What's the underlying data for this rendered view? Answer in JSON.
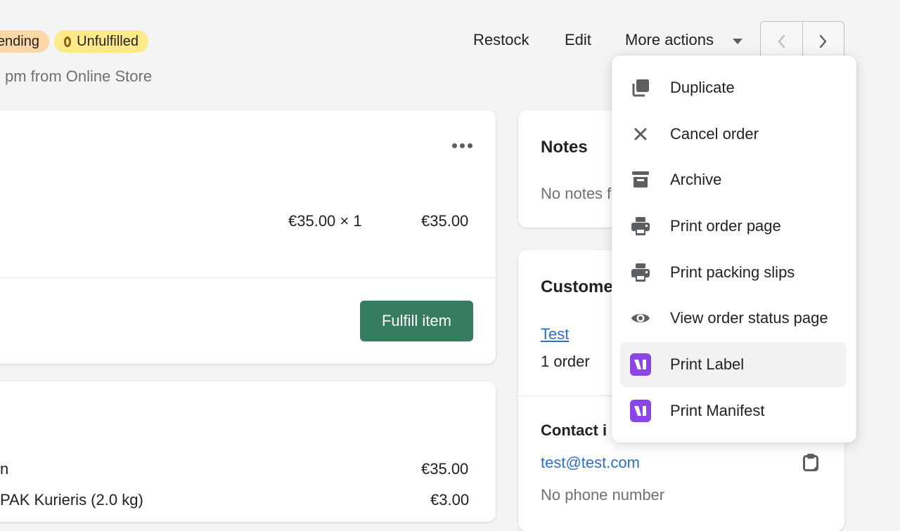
{
  "header": {
    "badges": [
      {
        "label": "Pending",
        "visible_text": "ending",
        "color": "#fcd8a8"
      },
      {
        "label": "Unfulfilled",
        "color": "#ffea8a"
      }
    ],
    "subtitle": "pm from Online Store",
    "actions": {
      "restock": "Restock",
      "edit": "Edit",
      "more_actions": "More actions"
    },
    "pager": {
      "prev": "previous-order",
      "next": "next-order"
    }
  },
  "line_item_card": {
    "unit_price_qty": "€35.00 × 1",
    "line_total": "€35.00",
    "fulfill_button": "Fulfill item",
    "accent": "#367c5e"
  },
  "payment_card": {
    "rows": [
      {
        "label": "n",
        "value": "€35.00"
      },
      {
        "label": "PAK Kurieris (2.0 kg)",
        "value": "€3.00"
      }
    ]
  },
  "notes_card": {
    "title": "Notes",
    "empty_text": "No notes f"
  },
  "customer_card": {
    "title": "Custome",
    "customer_name": "Test",
    "order_count": "1 order",
    "contact_title": "Contact i",
    "email": "test@test.com",
    "phone": "No phone number"
  },
  "more_actions_menu": {
    "items": [
      {
        "label": "Duplicate",
        "icon": "duplicate-icon"
      },
      {
        "label": "Cancel order",
        "icon": "close-icon"
      },
      {
        "label": "Archive",
        "icon": "archive-icon"
      },
      {
        "label": "Print order page",
        "icon": "printer-icon"
      },
      {
        "label": "Print packing slips",
        "icon": "printer-icon"
      },
      {
        "label": "View order status page",
        "icon": "eye-icon"
      },
      {
        "label": "Print Label",
        "icon": "app-logo-icon",
        "highlighted": true
      },
      {
        "label": "Print Manifest",
        "icon": "app-logo-icon"
      }
    ],
    "app_icon_color": "#8b45e6"
  }
}
